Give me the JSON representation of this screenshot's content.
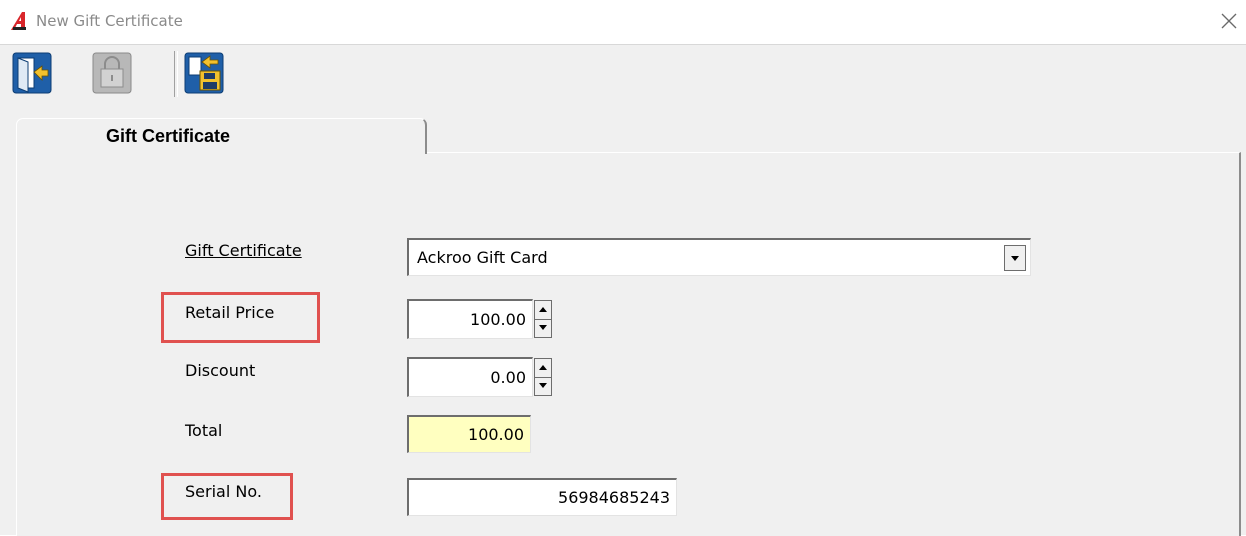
{
  "window": {
    "title": "New Gift Certificate"
  },
  "toolbar": {
    "buttons": [
      {
        "name": "exit",
        "icon": "exit-door-icon"
      },
      {
        "name": "lock",
        "icon": "lock-icon",
        "disabled": true
      },
      {
        "name": "save",
        "icon": "save-icon"
      }
    ]
  },
  "tabs": [
    {
      "label": "Gift Certificate",
      "active": true
    }
  ],
  "form": {
    "gift_certificate": {
      "label": "Gift Certificate",
      "value": "Ackroo Gift Card"
    },
    "retail_price": {
      "label": "Retail Price",
      "value": "100.00"
    },
    "discount": {
      "label": "Discount",
      "value": "0.00"
    },
    "total": {
      "label": "Total",
      "value": "100.00"
    },
    "serial_no": {
      "label": "Serial No.",
      "value": "56984685243"
    }
  },
  "colors": {
    "highlight_box": "#e0514f",
    "total_field_bg": "#ffffc0",
    "logo": "#d9262b"
  }
}
